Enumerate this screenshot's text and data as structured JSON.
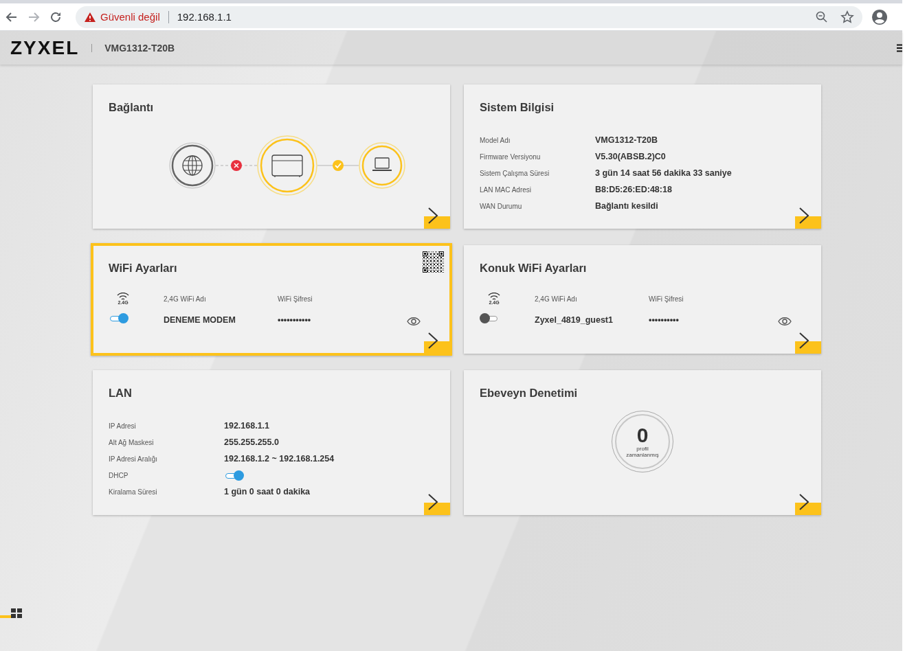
{
  "browser": {
    "security_warning": "Güvenli değil",
    "url": "192.168.1.1"
  },
  "header": {
    "logo": "ZYXEL",
    "model": "VMG1312-T20B"
  },
  "cards": [
    {
      "kind": "connection",
      "title": "Bağlantı",
      "wan_connected": false,
      "lan_connected": true
    },
    {
      "kind": "info",
      "title": "Sistem Bilgisi",
      "rows": [
        {
          "kind": "text",
          "label": "Model Adı",
          "value": "VMG1312-T20B"
        },
        {
          "kind": "text",
          "label": "Firmware Versiyonu",
          "value": "V5.30(ABSB.2)C0"
        },
        {
          "kind": "text",
          "label": "Sistem Çalışma Süresi",
          "value": "3 gün 14 saat 56 dakika 33 saniye"
        },
        {
          "kind": "text",
          "label": "LAN MAC Adresi",
          "value": "B8:D5:26:ED:48:18"
        },
        {
          "kind": "text",
          "label": "WAN Durumu",
          "value": "Bağlantı kesildi"
        }
      ]
    },
    {
      "kind": "wifi",
      "title": "WiFi Ayarları",
      "selected": true,
      "qr_code": true,
      "band": "2.4G",
      "name_label": "2,4G WiFi Adı",
      "password_label": "WiFi Şifresi",
      "name": "DENEME MODEM",
      "password": "•••••••••••",
      "on": true
    },
    {
      "kind": "wifi",
      "title": "Konuk WiFi Ayarları",
      "selected": false,
      "qr_code": false,
      "band": "2.4G",
      "name_label": "2,4G WiFi Adı",
      "password_label": "WiFi Şifresi",
      "name": "Zyxel_4819_guest1",
      "password": "••••••••••",
      "on": false
    },
    {
      "kind": "info",
      "title": "LAN",
      "rows": [
        {
          "kind": "text",
          "label": "IP Adresi",
          "value": "192.168.1.1"
        },
        {
          "kind": "text",
          "label": "Alt Ağ Maskesi",
          "value": "255.255.255.0"
        },
        {
          "kind": "text",
          "label": "IP Adresi Aralığı",
          "value": "192.168.1.2 ~ 192.168.1.254"
        },
        {
          "kind": "toggle",
          "label": "DHCP",
          "on": true
        },
        {
          "kind": "text",
          "label": "Kiralama Süresi",
          "value": "1 gün 0 saat 0 dakika"
        }
      ]
    },
    {
      "kind": "parental",
      "title": "Ebeveyn Denetimi",
      "count": "0",
      "caption": [
        "profil",
        "zamanlanmış"
      ]
    }
  ]
}
